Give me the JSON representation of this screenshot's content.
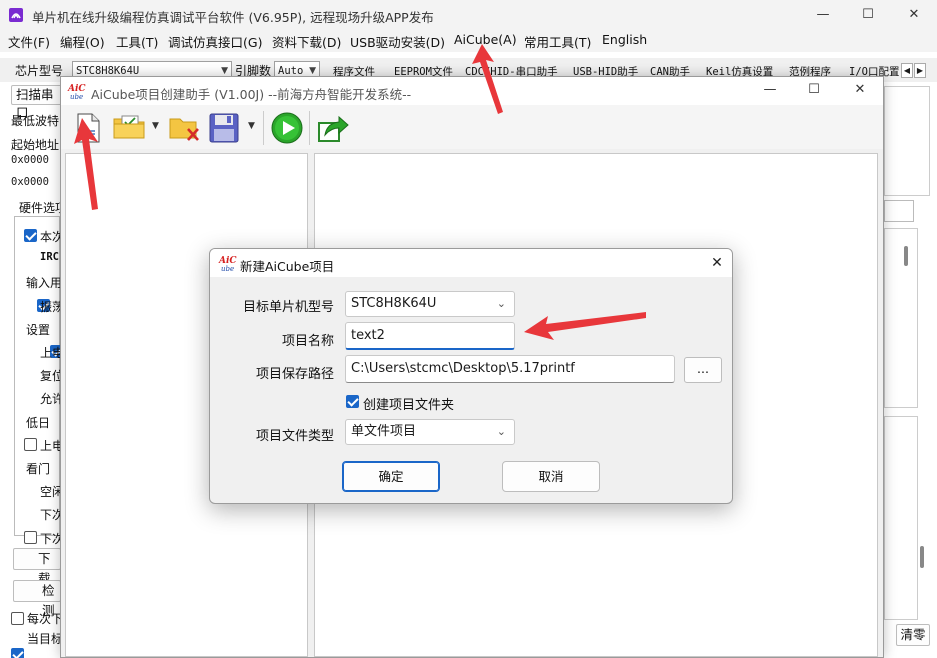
{
  "main_window": {
    "title": "单片机在线升级编程仿真调试平台软件 (V6.95P), 远程现场升级APP发布",
    "controls": {
      "minimize": "—",
      "maximize": "☐",
      "close": "✕"
    }
  },
  "menu": {
    "items": [
      "文件(F)",
      "编程(O)",
      "工具(T)",
      "调试仿真接口(G)",
      "资料下载(D)",
      "USB驱动安装(D)",
      "AiCube(A)",
      "常用工具(T)",
      "English"
    ]
  },
  "toolbar": {
    "chip_label": "芯片型号",
    "chip_value": "STC8H8K64U",
    "pin_label": "引脚数",
    "pin_value": "Auto",
    "tabs": [
      "程序文件",
      "EEPROM文件",
      "CDC/HID-串口助手",
      "USB-HID助手",
      "CAN助手",
      "Keil仿真设置",
      "范例程序",
      "I/O口配置"
    ]
  },
  "left_panel": {
    "scan_button": "扫描串口",
    "min_baud_label": "最低波特",
    "start_addr_label": "起始地址",
    "addr1": "0x0000",
    "addr2": "0x0000",
    "hw_options_label": "硬件选项",
    "options": [
      {
        "text": "本次",
        "checked": true
      },
      {
        "text": "IRC",
        "checked": null
      },
      {
        "text": "输入用",
        "checked": null
      },
      {
        "text": "振荡",
        "checked": true
      },
      {
        "text": "设置",
        "checked": null
      },
      {
        "text": "上电",
        "checked": true
      },
      {
        "text": "复位",
        "checked": true
      },
      {
        "text": "允许",
        "checked": true
      },
      {
        "text": "低日",
        "checked": null
      },
      {
        "text": "上电",
        "checked": false
      },
      {
        "text": "看门",
        "checked": null
      },
      {
        "text": "空闲",
        "checked": true
      },
      {
        "text": "下次",
        "checked": true
      },
      {
        "text": "下次",
        "checked": false
      }
    ],
    "download_button": "下载",
    "check_button": "检测",
    "every_label": "每次下",
    "current_label": "当目标"
  },
  "right_panel": {
    "clear_button": "清零"
  },
  "aicube": {
    "title": "AiCube项目创建助手 (V1.00J) --前海方舟智能开发系统--",
    "logo_text": "AiCube",
    "toolbar_icons": [
      "new-project-icon",
      "open-folder-icon",
      "close-project-icon",
      "save-icon",
      "run-icon",
      "export-icon"
    ]
  },
  "dialog": {
    "title": "新建AiCube项目",
    "logo_text": "AiCube",
    "fields": {
      "chip_label": "目标单片机型号",
      "chip_value": "STC8H8K64U",
      "name_label": "项目名称",
      "name_value": "text2",
      "path_label": "项目保存路径",
      "path_value": "C:\\Users\\stcmc\\Desktop\\5.17printf",
      "browse_label": "...",
      "create_folder_label": "创建项目文件夹",
      "create_folder_checked": true,
      "type_label": "项目文件类型",
      "type_value": "单文件项目"
    },
    "ok_label": "确定",
    "cancel_label": "取消"
  },
  "colors": {
    "accent": "#1a66c8",
    "annotation_arrow": "#e8373b",
    "run_green": "#2aa52a"
  }
}
